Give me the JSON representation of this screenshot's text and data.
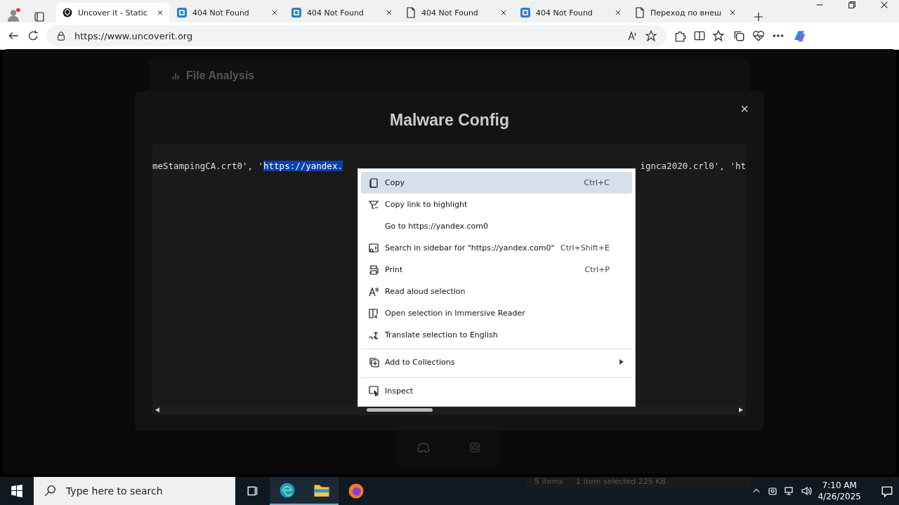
{
  "tabs": [
    {
      "label": "Uncover it - Static",
      "selected": true
    },
    {
      "label": "404 Not Found",
      "selected": false
    },
    {
      "label": "404 Not Found",
      "selected": false
    },
    {
      "label": "404 Not Found",
      "selected": false
    },
    {
      "label": "404 Not Found",
      "selected": false
    },
    {
      "label": "Переход по внеш",
      "selected": false
    }
  ],
  "address_bar": {
    "value": "https://www.uncoverit.org"
  },
  "page": {
    "header": "File Analysis",
    "modal": {
      "title": "Malware Config",
      "close": "×",
      "code_line": {
        "before": "meStampingCA.crt0', '",
        "selected": "https://yandex.",
        "after": "ignca2020.crl0', 'ht"
      }
    }
  },
  "context_menu": [
    {
      "label": "Copy",
      "shortcut": "Ctrl+C",
      "selected": true,
      "separator_before": false,
      "submenu": false
    },
    {
      "label": "Copy link to highlight",
      "selected": false,
      "separator_before": false,
      "submenu": false
    },
    {
      "label": "Go to https://yandex.com0",
      "selected": false,
      "separator_before": false,
      "submenu": false
    },
    {
      "label": "Search in sidebar for \"https://yandex.com0\"",
      "shortcut": "Ctrl+Shift+E",
      "selected": false,
      "separator_before": false,
      "submenu": false
    },
    {
      "label": "Print",
      "shortcut": "Ctrl+P",
      "selected": false,
      "separator_before": false,
      "submenu": false
    },
    {
      "label": "Read aloud selection",
      "selected": false,
      "separator_before": false,
      "submenu": false
    },
    {
      "label": "Open selection in Immersive Reader",
      "selected": false,
      "separator_before": false,
      "submenu": false
    },
    {
      "label": "Translate selection to English",
      "selected": false,
      "separator_before": false,
      "submenu": false
    },
    {
      "label": "Add to Collections",
      "selected": false,
      "separator_before": true,
      "submenu": true
    },
    {
      "label": "Inspect",
      "selected": false,
      "separator_before": true,
      "submenu": false
    }
  ],
  "taskbar": {
    "search": {
      "placeholder": "Type here to search"
    },
    "explorer_status": [
      "5 items",
      "1 item selected  225 KB"
    ],
    "time": "7:10 AM",
    "date": "4/26/2025"
  }
}
